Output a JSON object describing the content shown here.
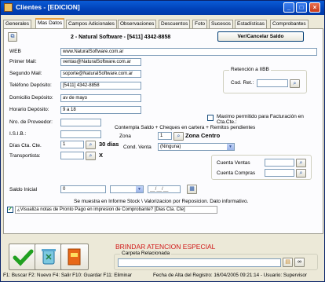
{
  "window": {
    "title": "Clientes - [EDICION]"
  },
  "tabs": [
    "Generales",
    "Mas Datos",
    "Campos Adicionales",
    "Observaciones",
    "Descuentos",
    "Foto",
    "Sucesos",
    "Estadísticas",
    "Comprobantes"
  ],
  "header": {
    "client": "2 - Natural Software - [5411] 4342-8858",
    "toggle_button": "Ver/Cancelar Saldo"
  },
  "form": {
    "web_label": "WEB",
    "web_value": "www.NaturalSoftware.com.ar",
    "mail1_label": "Primer Mail:",
    "mail1_value": "ventas@NaturalSoftware.com.ar",
    "mail2_label": "Segundo Mail:",
    "mail2_value": "soporte@NaturalSoftware.com.ar",
    "tel_label": "Teléfono Depósito:",
    "tel_value": "[5411] 4342-8858",
    "dom_label": "Domicilio Depósito:",
    "dom_value": "av de mayo",
    "hor_label": "Horario Depósito:",
    "hor_value": "9 a 18",
    "prov_label": "Nro. de Proveedor:",
    "prov_value": "",
    "isib_label": "I.S.I.B.:",
    "isib_value": "",
    "dias_label": "Días Cta. Cte.",
    "dias_value": "1",
    "dias_text": "30 dias",
    "transp_label": "Transportista:",
    "transp_value": "",
    "transp_text": "X",
    "saldo_label": "Saldo Inicial",
    "saldo_value": "0",
    "saldo_combo": "",
    "saldo_date": "__/__/__"
  },
  "retencion": {
    "title": "Retención a IIBB",
    "cod_label": "Cod. Ret.:",
    "cod_value": ""
  },
  "maximo": {
    "label": "Maximo permitido para Facturación en Cta.Cte.:",
    "checked": false
  },
  "contempla": {
    "label": "Contempla Saldo + Cheques en cartera + Remitos pendientes"
  },
  "zona": {
    "label": "Zona",
    "value": "1",
    "text": "Zona Centro"
  },
  "cond_venta": {
    "label": "Cond. Venta",
    "value": "(Ninguna)"
  },
  "cuentas": {
    "ventas_label": "Cuenta Ventas",
    "compras_label": "Cuenta Compras"
  },
  "info_text": "Se muestra en Informe Stock \\ Valorizacion por Reposicion. Dato informativo.",
  "notas_check": {
    "label": "¿Visualiza notas de Pronto Pago en impresion de Comprobante? [Dias Cta. Cte]",
    "checked": true
  },
  "banner": "BRINDAR ATENCION ESPECIAL",
  "carpeta": {
    "label": "Carpeta Relacionada",
    "value": ""
  },
  "status": {
    "keys": "F1: Buscar  F2: Nuevo  F4: Salir  F10: Guardar  F11: Eliminar",
    "info": "Fecha de Alta del Registro: 16/04/2005 09:21:14 - Usuario: Supervisor"
  },
  "colors": {
    "title_bar": "#0041b8",
    "banner": "#d01818",
    "dias_bold": "#000000"
  }
}
